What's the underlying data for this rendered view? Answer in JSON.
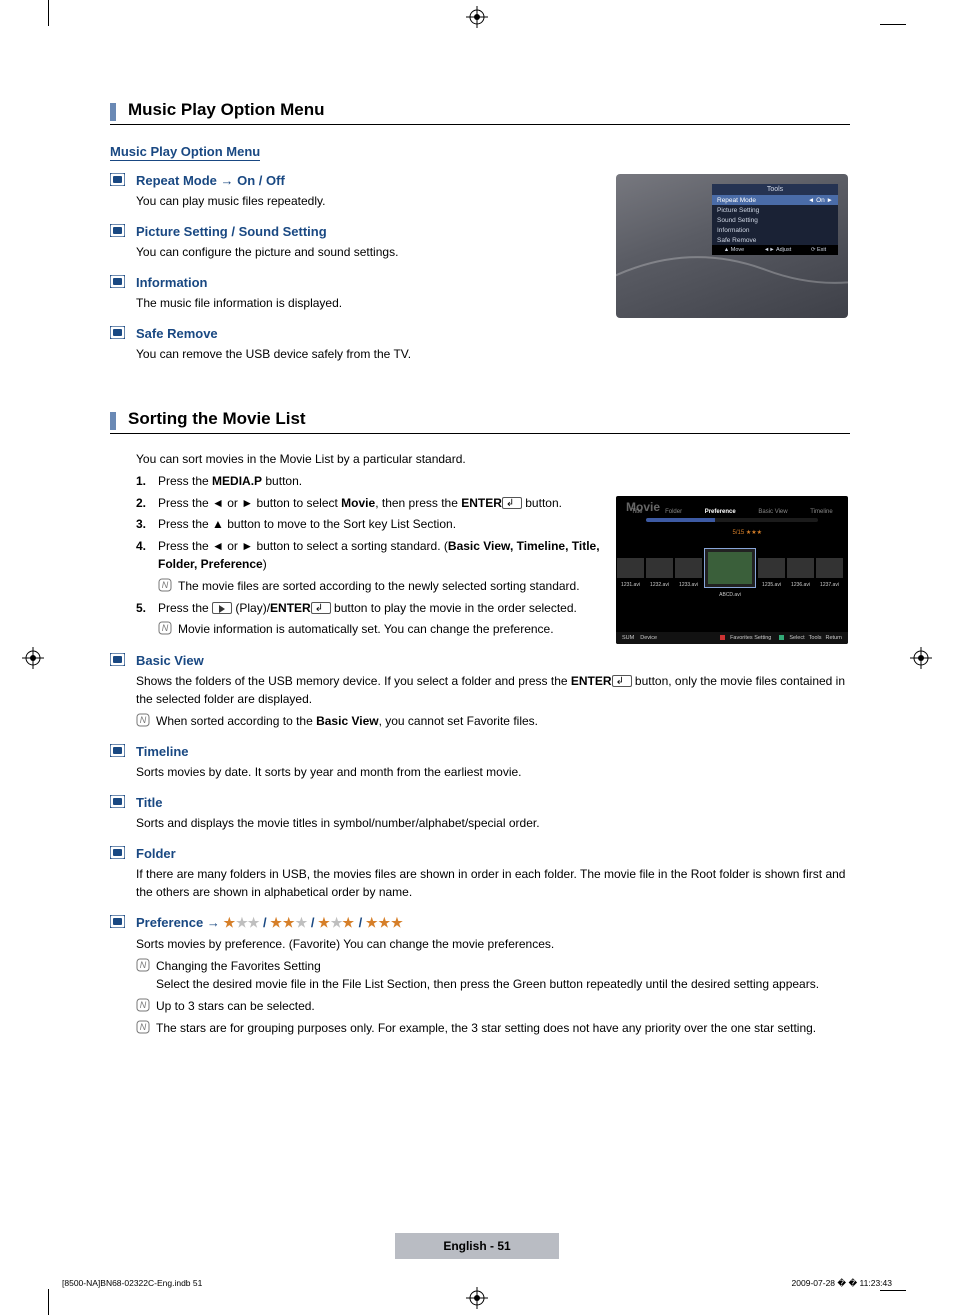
{
  "section1": {
    "heading": "Music Play Option Menu",
    "subheading": "Music Play Option Menu",
    "options": [
      {
        "title": "Repeat Mode → On / Off",
        "desc": "You can play music files repeatedly."
      },
      {
        "title": "Picture Setting / Sound Setting",
        "desc": "You can configure the picture and sound settings."
      },
      {
        "title": "Information",
        "desc": "The music file information is displayed."
      },
      {
        "title": "Safe Remove",
        "desc": "You can remove the USB device safely from the TV."
      }
    ]
  },
  "figure1": {
    "title": "Tools",
    "rows": [
      "Repeat Mode",
      "Picture Setting",
      "Sound Setting",
      "Information",
      "Safe Remove"
    ],
    "selValue": "On",
    "footer": [
      "▲ Move",
      "◄► Adjust",
      "⟳ Exit"
    ]
  },
  "section2": {
    "heading": "Sorting the Movie List",
    "intro": "You can sort movies in the Movie List by a particular standard.",
    "steps": {
      "s1_a": "Press the ",
      "s1_b": "MEDIA.P",
      "s1_c": " button.",
      "s2_a": "Press the ◄ or ► button to select ",
      "s2_b": "Movie",
      "s2_c": ", then press the ",
      "s2_d": "ENTER",
      "s2_e": " button.",
      "s3": "Press the ▲ button to move to the Sort key List Section.",
      "s4_a": "Press the ◄ or ► button to select a sorting standard. (",
      "s4_b": "Basic View, Timeline, Title, Folder, Preference",
      "s4_c": ")",
      "s4_note": "The movie files are sorted according to the newly selected sorting standard.",
      "s5_a": "Press the ",
      "s5_b": " (Play)/",
      "s5_c": "ENTER",
      "s5_d": " button to play the movie in the order selected.",
      "s5_note": "Movie information is automatically set. You can change the preference."
    },
    "basic_view": {
      "title": "Basic View",
      "desc_a": "Shows the folders of the USB memory device. If you select a folder and press the ",
      "desc_b": "ENTER",
      "desc_c": " button, only the movie files contained in the selected folder are displayed.",
      "note_a": "When sorted according to the ",
      "note_b": "Basic View",
      "note_c": ", you cannot set Favorite files."
    },
    "timeline": {
      "title": "Timeline",
      "desc": "Sorts movies by date. It sorts by year and month from the earliest movie."
    },
    "title_sort": {
      "title": "Title",
      "desc": "Sorts and displays the movie titles in symbol/number/alphabet/special order."
    },
    "folder": {
      "title": "Folder",
      "desc": "If there are many folders in USB, the movies files are shown in order in each folder. The movie file in the Root folder is shown first and the others are shown in alphabetical order by name."
    },
    "preference": {
      "title": "Preference → ",
      "desc": "Sorts movies by preference. (Favorite) You can change the movie preferences.",
      "note1_a": "Changing the Favorites Setting",
      "note1_b": "Select the desired movie file in the File List Section, then press the Green button repeatedly until the desired setting appears.",
      "note2": "Up to 3 stars can be selected.",
      "note3": "The stars are for grouping purposes only. For example, the 3 star setting does not have any priority over the one star setting."
    }
  },
  "figure2": {
    "title": "Movie",
    "tabs": [
      "Title",
      "Folder",
      "Preference",
      "Basic View",
      "Timeline"
    ],
    "selected_file": "ABCD.avi",
    "thumb_labels": [
      "1231.avi",
      "1232.avi",
      "1233.avi",
      "",
      "1235.avi",
      "1236.avi",
      "1237.avi"
    ],
    "footer_left": [
      "SUM",
      "Device"
    ],
    "footer_right": [
      "Favorites Setting",
      "Select",
      "Tools",
      "Return"
    ]
  },
  "page_footer": "English - 51",
  "meta_left": "[8500-NA]BN68-02322C-Eng.indb   51",
  "meta_right": "2009-07-28   � � 11:23:43"
}
